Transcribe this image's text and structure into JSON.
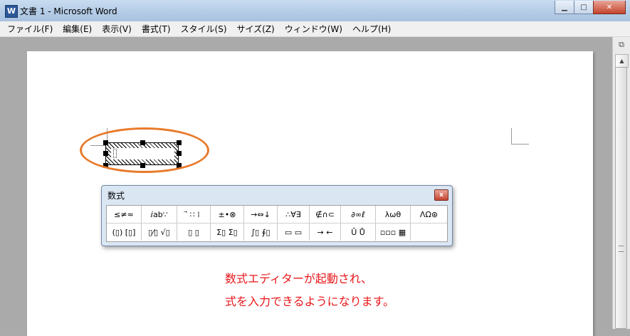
{
  "window": {
    "app_icon": "W",
    "title": "文書 1 - Microsoft Word",
    "controls": [
      "minimize",
      "maximize",
      "close"
    ]
  },
  "menu": {
    "items": [
      {
        "label": "ファイル(F)"
      },
      {
        "label": "編集(E)"
      },
      {
        "label": "表示(V)"
      },
      {
        "label": "書式(T)"
      },
      {
        "label": "スタイル(S)"
      },
      {
        "label": "サイズ(Z)"
      },
      {
        "label": "ウィンドウ(W)"
      },
      {
        "label": "ヘルプ(H)"
      }
    ]
  },
  "equation_toolbar": {
    "title": "数式",
    "close_label": "x",
    "row1": [
      "≤≠≈",
      "ⅈab∵",
      "⃗ ∷ ⁞",
      "±•⊗",
      "→⇔↓",
      "∴∀∃",
      "∉∩⊂",
      "∂∞ℓ",
      "λωθ",
      "ΛΩ⊛"
    ],
    "row2": [
      "(▯) [▯]",
      "▯⁄▯ √▯",
      "▯ ▯",
      "Σ▯ Σ▯",
      "∫▯ ∮▯",
      "▭ ▭",
      "→ ←",
      "Ū Ů",
      "▫▫▫ ▦",
      ""
    ]
  },
  "caption": {
    "line1": "数式エディターが起動され、",
    "line2": "式を入力できるようになります。",
    "color": "#e8161a"
  },
  "highlight_color": "#e87a2a"
}
